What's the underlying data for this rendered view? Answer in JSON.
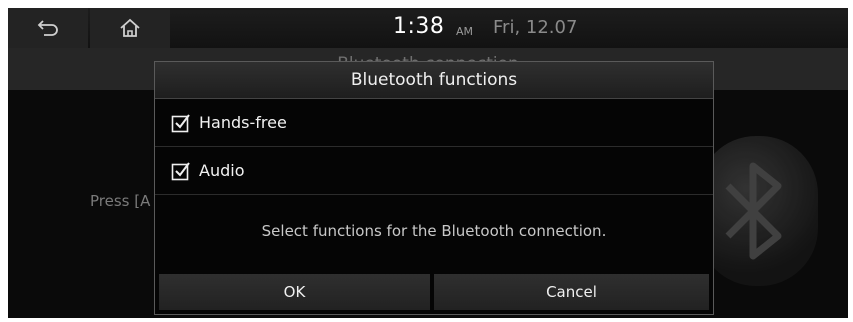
{
  "status_bar": {
    "back_icon": "back-arrow-icon",
    "home_icon": "home-icon",
    "time": "1:38",
    "ampm": "AM",
    "date": "Fri, 12.07"
  },
  "background": {
    "title": "Bluetooth connection",
    "press_text": "Press [A"
  },
  "dialog": {
    "title": "Bluetooth functions",
    "options": [
      {
        "label": "Hands-free",
        "checked": true
      },
      {
        "label": "Audio",
        "checked": true
      }
    ],
    "message": "Select functions for the Bluetooth connection.",
    "ok_label": "OK",
    "cancel_label": "Cancel"
  },
  "colors": {
    "screen_bg": "#0a0a0a",
    "dialog_border": "#5a5a5a",
    "button_bg": "#2a2a2a"
  }
}
